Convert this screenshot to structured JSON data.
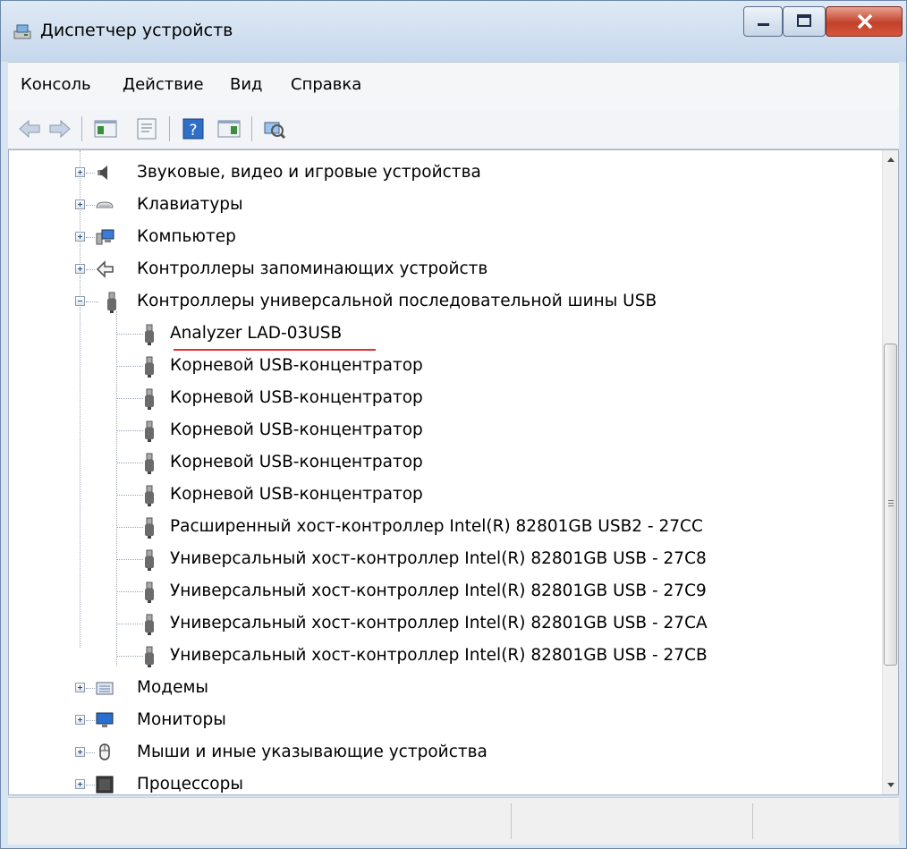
{
  "window": {
    "title": "Диспетчер устройств"
  },
  "menu": {
    "items": [
      "Консоль",
      "Действие",
      "Вид",
      "Справка"
    ]
  },
  "toolbar": {
    "buttons": [
      "back-arrow-icon",
      "forward-arrow-icon",
      "show-hide-tree-icon",
      "properties-icon",
      "help-icon",
      "action-pane-icon",
      "scan-hardware-icon"
    ]
  },
  "tree": {
    "categories_top": [
      {
        "label": "Звуковые, видео и игровые устройства",
        "icon": "speaker-icon"
      },
      {
        "label": "Клавиатуры",
        "icon": "keyboard-icon"
      },
      {
        "label": "Компьютер",
        "icon": "computer-icon"
      },
      {
        "label": "Контроллеры запоминающих устройств",
        "icon": "storage-controller-icon"
      },
      {
        "label": "Контроллеры универсальной последовательной шины USB",
        "icon": "usb-plug-icon"
      }
    ],
    "usb_children": [
      "Analyzer LAD-03USB",
      "Корневой USB-концентратор",
      "Корневой USB-концентратор",
      "Корневой USB-концентратор",
      "Корневой USB-концентратор",
      "Корневой USB-концентратор",
      "Расширенный хост-контроллер Intel(R) 82801GB USB2 - 27CC",
      "Универсальный хост-контроллер Intel(R) 82801GB USB - 27C8",
      "Универсальный хост-контроллер Intel(R) 82801GB USB - 27C9",
      "Универсальный хост-контроллер Intel(R) 82801GB USB - 27CA",
      "Универсальный хост-контроллер Intel(R) 82801GB USB - 27CB"
    ],
    "categories_bottom": [
      {
        "label": "Модемы",
        "icon": "modem-icon"
      },
      {
        "label": "Мониторы",
        "icon": "monitor-icon"
      },
      {
        "label": "Мыши и иные указывающие устройства",
        "icon": "mouse-icon"
      },
      {
        "label": "Процессоры",
        "icon": "processor-icon"
      }
    ]
  },
  "colors": {
    "highlight_underline": "#e03030"
  }
}
